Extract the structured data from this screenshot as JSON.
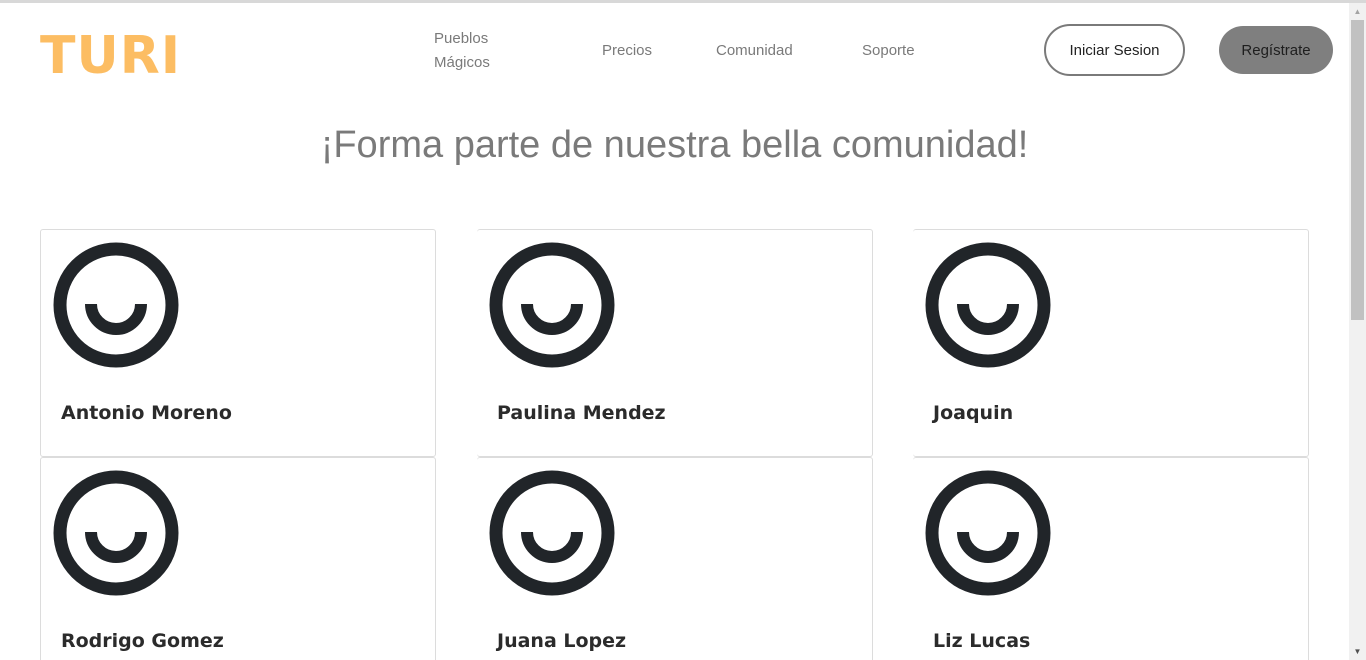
{
  "header": {
    "logo": "TURI",
    "nav": {
      "pueblos_line1": "Pueblos",
      "pueblos_line2": "Mágicos",
      "precios": "Precios",
      "comunidad": "Comunidad",
      "soporte": "Soporte"
    },
    "login_label": "Iniciar Sesion",
    "register_label": "Regístrate"
  },
  "main": {
    "headline": "¡Forma parte de nuestra bella comunidad!",
    "members": [
      {
        "name": "Antonio Moreno",
        "icon": "smiley-face-icon"
      },
      {
        "name": "Paulina Mendez",
        "icon": "smiley-face-icon"
      },
      {
        "name": "Joaquin",
        "icon": "smiley-face-icon"
      },
      {
        "name": "Rodrigo Gomez",
        "icon": "smiley-face-icon"
      },
      {
        "name": "Juana Lopez",
        "icon": "smiley-face-icon"
      },
      {
        "name": "Liz Lucas",
        "icon": "smiley-face-icon"
      }
    ]
  },
  "colors": {
    "logo": "#fcbd63",
    "nav_text": "#7a7a7a",
    "register_bg": "#7f7f7f",
    "avatar": "#212529"
  }
}
